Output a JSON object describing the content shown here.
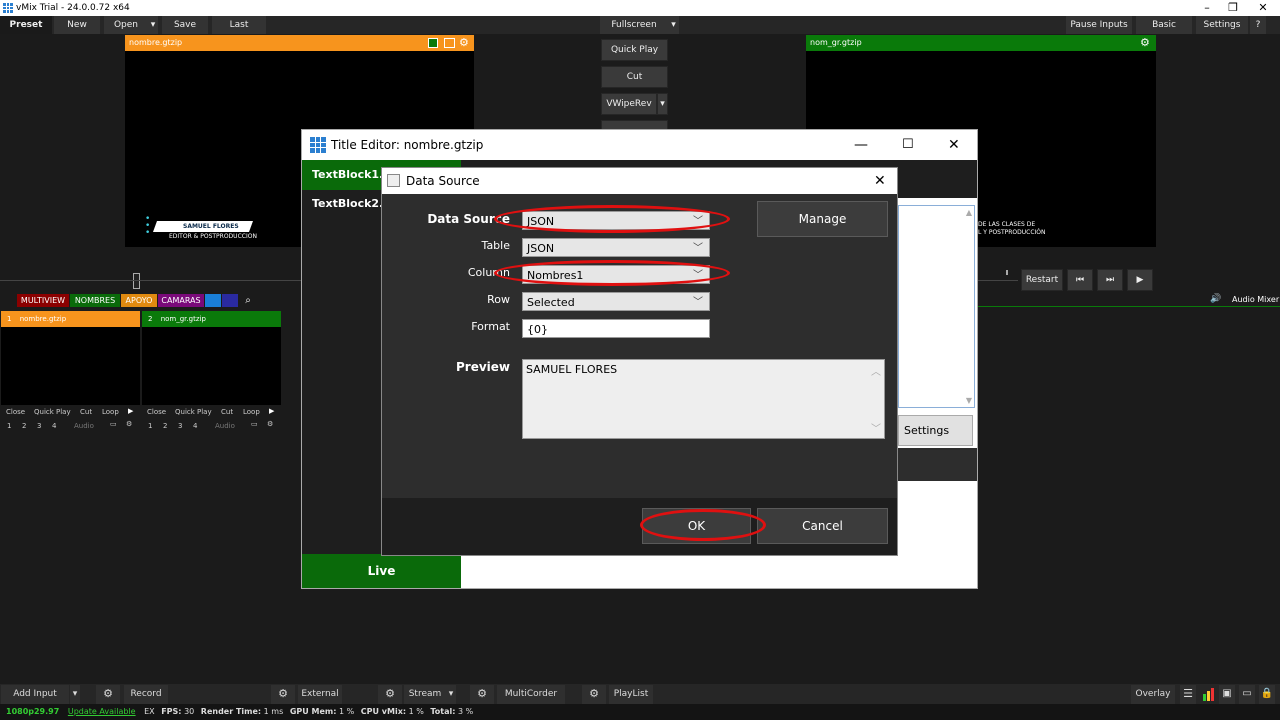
{
  "window": {
    "title": "vMix Trial - 24.0.0.72 x64",
    "min": "–",
    "max": "❐",
    "close": "✕"
  },
  "menubar": {
    "preset": "Preset",
    "new": "New",
    "open": "Open",
    "save": "Save",
    "last": "Last",
    "fullscreen": "Fullscreen",
    "pause_inputs": "Pause Inputs",
    "basic": "Basic",
    "settings": "Settings",
    "help": "?"
  },
  "preview": {
    "title": "nombre.gtzip",
    "lt_name": "SAMUEL FLORES",
    "lt_role": "EDITOR & POSTPRODUCCION"
  },
  "output": {
    "title": "nom_gr.gtzip",
    "lt_line1": "DE LAS CLASES DE",
    "lt_line2": "L Y POSTPRODUCCIÓN"
  },
  "transitions": {
    "quick_play": "Quick Play",
    "cut": "Cut",
    "wipe": "VWipeRev"
  },
  "playback": {
    "restart": "Restart",
    "rewind": "⏮",
    "forward": "⏭",
    "play": "▶",
    "audio_mixer": "Audio Mixer"
  },
  "tabs": {
    "multiview": "MULTIVIEW",
    "nombres": "NOMBRES",
    "apoyo": "APOYO",
    "camaras": "CAMARAS"
  },
  "inputs": [
    {
      "num": "1",
      "name": "nombre.gtzip",
      "color": "#f7941d"
    },
    {
      "num": "2",
      "name": "nom_gr.gtzip",
      "color": "#0a7a0a"
    }
  ],
  "input_controls": {
    "close": "Close",
    "quick_play": "Quick Play",
    "cut": "Cut",
    "loop": "Loop",
    "n1": "1",
    "n2": "2",
    "n3": "3",
    "n4": "4",
    "audio": "Audio"
  },
  "bottombar": {
    "add_input": "Add Input",
    "record": "Record",
    "external": "External",
    "stream": "Stream",
    "multicorder": "MultiCorder",
    "playlist": "PlayList",
    "overlay": "Overlay"
  },
  "status": {
    "format": "1080p29.97",
    "update": "Update Available",
    "ex": "EX",
    "fps_label": "FPS:",
    "fps": "30",
    "render_label": "Render Time:",
    "render": "1 ms",
    "gpu_label": "GPU Mem:",
    "gpu": "1 %",
    "cpu_label": "CPU vMix:",
    "cpu": "1 %",
    "total_label": "Total:",
    "total": "3 %"
  },
  "title_editor": {
    "title": "Title Editor: nombre.gtzip",
    "block1": "TextBlock1.T",
    "block2": "TextBlock2.T",
    "live": "Live",
    "settings": "Settings"
  },
  "data_source": {
    "title": "Data Source",
    "data_source_label": "Data Source",
    "data_source_value": "JSON",
    "table_label": "Table",
    "table_value": "JSON",
    "column_label": "Column",
    "column_value": "Nombres1",
    "row_label": "Row",
    "row_value": "Selected",
    "format_label": "Format",
    "format_value": "{0}",
    "preview_label": "Preview",
    "preview_value": "SAMUEL FLORES",
    "manage": "Manage",
    "ok": "OK",
    "cancel": "Cancel"
  },
  "colors": {
    "orange": "#f7941d",
    "green": "#0a7a0a",
    "annotation_red": "#e01010"
  }
}
